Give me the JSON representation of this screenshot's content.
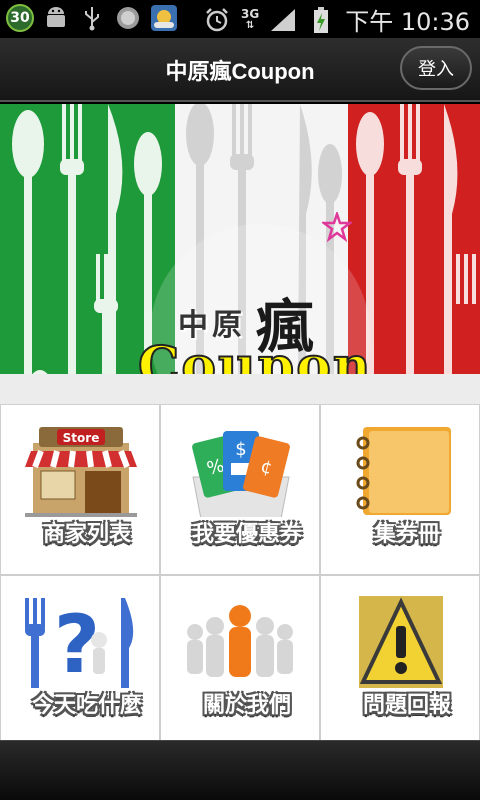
{
  "status": {
    "notif_count": "30",
    "network": "3G",
    "time": "下午 10:36"
  },
  "appbar": {
    "title": "中原瘋Coupon",
    "login_label": "登入"
  },
  "banner": {
    "logo_zh": "中原",
    "logo_crazy": "瘋",
    "logo_en": "Coupon"
  },
  "menu": [
    {
      "label": "商家列表",
      "icon": "store-icon"
    },
    {
      "label": "我要優惠券",
      "icon": "coupons-icon"
    },
    {
      "label": "集券冊",
      "icon": "notebook-icon"
    },
    {
      "label": "今天吃什麼",
      "icon": "question-utensils-icon"
    },
    {
      "label": "關於我們",
      "icon": "team-icon"
    },
    {
      "label": "問題回報",
      "icon": "warning-icon"
    }
  ],
  "colors": {
    "green": "#1f9a3a",
    "white": "#f4f4f4",
    "red": "#d02020",
    "logo_yellow": "#fff200"
  }
}
